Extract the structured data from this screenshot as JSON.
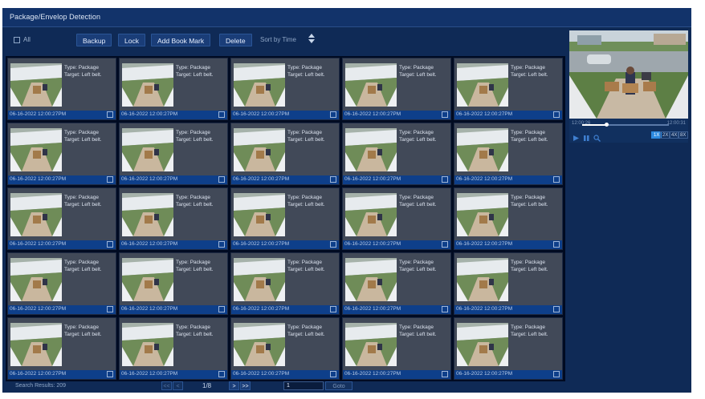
{
  "window": {
    "title": "Package/Envelop Detection"
  },
  "toolbar": {
    "all_label": "All",
    "buttons": [
      "Backup",
      "Lock",
      "Add Book Mark",
      "Delete"
    ],
    "sort_label": "Sort by Time"
  },
  "grid": {
    "rows": 5,
    "cols": 5,
    "items": [
      {
        "type": "Type: Package",
        "target": "Target: Left belt.",
        "datetime": "06-16-2022 12:00:27PM"
      },
      {
        "type": "Type: Package",
        "target": "Target: Left belt.",
        "datetime": "06-16-2022 12:00:27PM"
      },
      {
        "type": "Type: Package",
        "target": "Target: Left belt.",
        "datetime": "06-16-2022 12:00:27PM"
      },
      {
        "type": "Type: Package",
        "target": "Target: Left belt.",
        "datetime": "06-16-2022 12:00:27PM"
      },
      {
        "type": "Type: Package",
        "target": "Target: Left belt.",
        "datetime": "06-16-2022 12:00:27PM"
      },
      {
        "type": "Type: Package",
        "target": "Target: Left belt.",
        "datetime": "06-16-2022 12:00:27PM"
      },
      {
        "type": "Type: Package",
        "target": "Target: Left belt.",
        "datetime": "06-16-2022 12:00:27PM"
      },
      {
        "type": "Type: Package",
        "target": "Target: Left belt.",
        "datetime": "06-16-2022 12:00:27PM"
      },
      {
        "type": "Type: Package",
        "target": "Target: Left belt.",
        "datetime": "06-16-2022 12:00:27PM"
      },
      {
        "type": "Type: Package",
        "target": "Target: Left belt.",
        "datetime": "06-16-2022 12:00:27PM"
      },
      {
        "type": "Type: Package",
        "target": "Target: Left belt.",
        "datetime": "06-16-2022 12:00:27PM"
      },
      {
        "type": "Type: Package",
        "target": "Target: Left belt.",
        "datetime": "06-16-2022 12:00:27PM"
      },
      {
        "type": "Type: Package",
        "target": "Target: Left belt.",
        "datetime": "06-16-2022 12:00:27PM"
      },
      {
        "type": "Type: Package",
        "target": "Target: Left belt.",
        "datetime": "06-16-2022 12:00:27PM"
      },
      {
        "type": "Type: Package",
        "target": "Target: Left belt.",
        "datetime": "06-16-2022 12:00:27PM"
      },
      {
        "type": "Type: Package",
        "target": "Target: Left belt.",
        "datetime": "06-16-2022 12:00:27PM"
      },
      {
        "type": "Type: Package",
        "target": "Target: Left belt.",
        "datetime": "06-16-2022 12:00:27PM"
      },
      {
        "type": "Type: Package",
        "target": "Target: Left belt.",
        "datetime": "06-16-2022 12:00:27PM"
      },
      {
        "type": "Type: Package",
        "target": "Target: Left belt.",
        "datetime": "06-16-2022 12:00:27PM"
      },
      {
        "type": "Type: Package",
        "target": "Target: Left belt.",
        "datetime": "06-16-2022 12:00:27PM"
      },
      {
        "type": "Type: Package",
        "target": "Target: Left belt.",
        "datetime": "06-16-2022 12:00:27PM"
      },
      {
        "type": "Type: Package",
        "target": "Target: Left belt.",
        "datetime": "06-16-2022 12:00:27PM"
      },
      {
        "type": "Type: Package",
        "target": "Target: Left belt.",
        "datetime": "06-16-2022 12:00:27PM"
      },
      {
        "type": "Type: Package",
        "target": "Target: Left belt.",
        "datetime": "06-16-2022 12:00:27PM"
      },
      {
        "type": "Type: Package",
        "target": "Target: Left belt.",
        "datetime": "06-16-2022 12:00:27PM"
      }
    ]
  },
  "preview": {
    "time_start": "12:00:26",
    "time_end": "12:00:31",
    "progress": 0.28,
    "speeds": [
      "1X",
      "2X",
      "4X",
      "8X"
    ],
    "active_speed": "1X",
    "icons": [
      "play-icon",
      "pause-icon",
      "zoom-icon"
    ]
  },
  "footer": {
    "results": "Search Results: 209",
    "page_indicator": "1/8",
    "page_input": "1",
    "goto_label": "Goto"
  },
  "colors": {
    "app_bg": "#0f2a56",
    "card_bg": "#414958",
    "date_strip": "#0e3f8a",
    "accent": "#2d8ae0"
  }
}
